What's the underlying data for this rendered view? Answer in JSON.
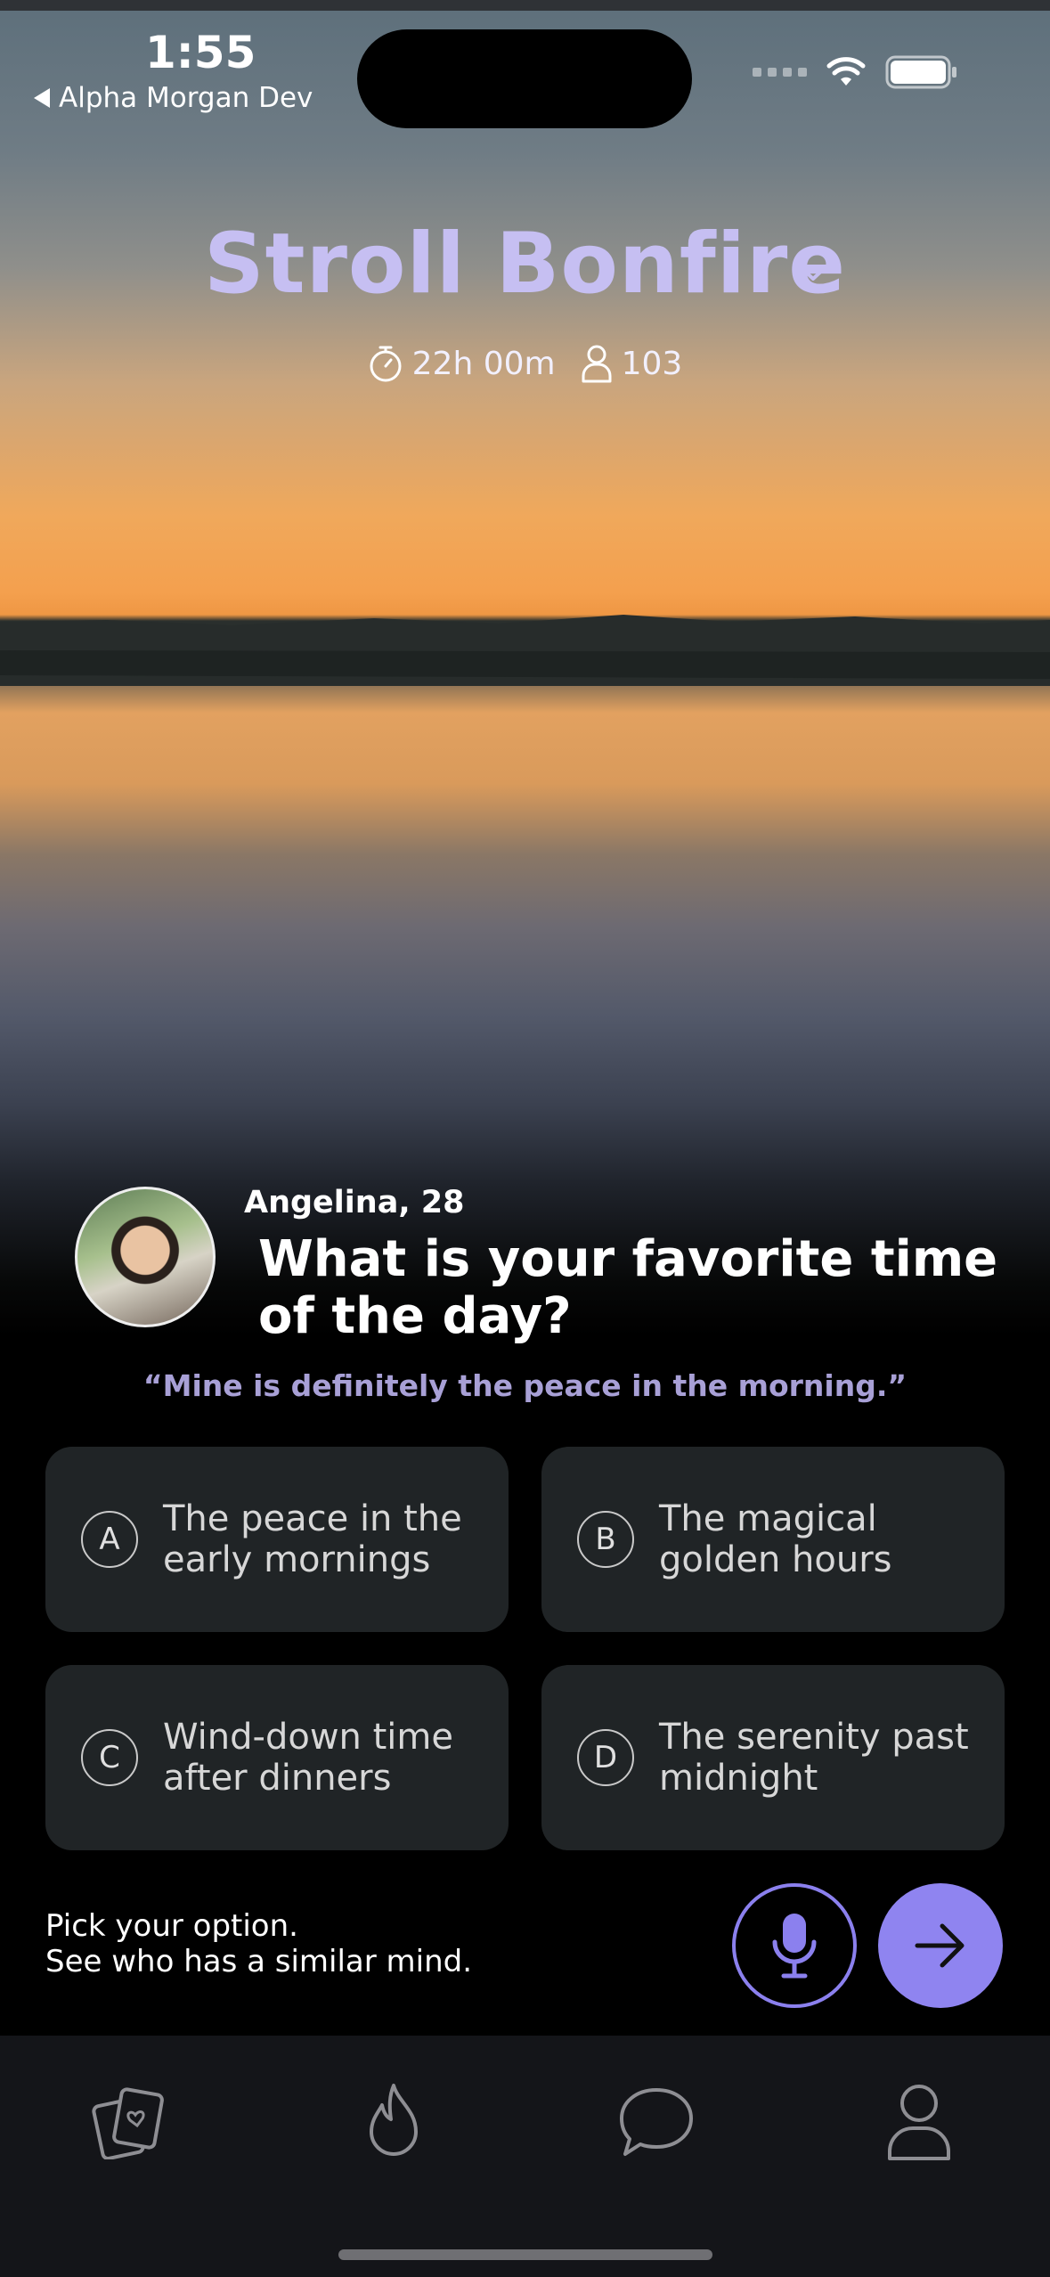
{
  "status_bar": {
    "time": "1:55",
    "back_app": "Alpha Morgan Dev"
  },
  "room": {
    "title": "Stroll Bonfire",
    "timer": "22h 00m",
    "participants": "103",
    "title_color": "#c6bff2"
  },
  "prompt": {
    "author": "Angelina, 28",
    "question": "What is your favorite time of the day?",
    "author_answer": "“Mine is definitely the peace in the morning.”"
  },
  "options": [
    {
      "letter": "A",
      "text": "The peace in the early mornings"
    },
    {
      "letter": "B",
      "text": "The magical golden hours"
    },
    {
      "letter": "C",
      "text": "Wind-down time after dinners"
    },
    {
      "letter": "D",
      "text": "The serenity past midnight"
    }
  ],
  "hint": {
    "line1": "Pick your option.",
    "line2": "See who has a similar mind."
  },
  "actions": {
    "mic_icon": "microphone-icon",
    "send_icon": "arrow-right-icon",
    "accent": "#8f84f0"
  },
  "tabs": [
    {
      "icon": "cards-icon"
    },
    {
      "icon": "flame-icon"
    },
    {
      "icon": "chat-bubble-icon"
    },
    {
      "icon": "profile-icon"
    }
  ]
}
